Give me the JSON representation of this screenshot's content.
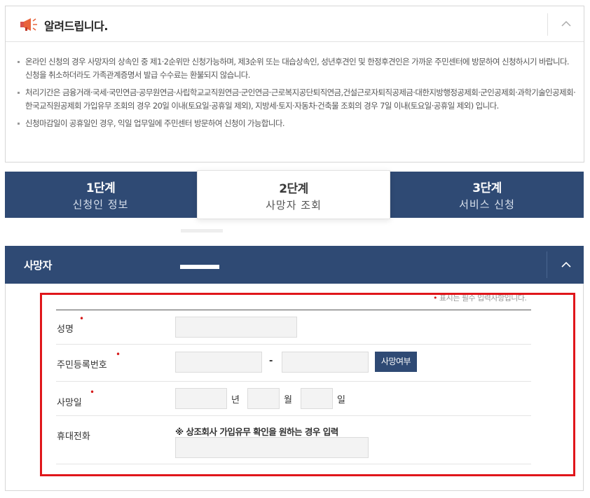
{
  "notice": {
    "title": "알려드립니다.",
    "items": [
      "온라인 신청의 경우 사망자의 상속인 중 제1·2순위만 신청가능하며, 제3순위 또는 대습상속인, 성년후견인 및 한정후견인은 가까운 주민센터에 방문하여 신청하시기 바랍니다. 신청을 취소하더라도 가족관계증명서 발급 수수료는 환불되지 않습니다.",
      "처리기간은 금융거래·국세·국민연금·공무원연금·사립학교교직원연금·군인연금·근로복지공단퇴직연금,건설근로자퇴직공제금·대한지방행정공제회·군인공제회·과학기술인공제회·한국교직원공제회 가입유무 조회의 경우 20일 이내(토요일·공휴일 제외), 지방세·토지·자동차·건축물 조회의 경우 7일 이내(토요일·공휴일 제외) 입니다.",
      "신청마감일이 공휴일인 경우, 익일 업무일에 주민센터 방문하여 신청이 가능합니다."
    ]
  },
  "steps": [
    {
      "num": "1단계",
      "label": "신청인 정보"
    },
    {
      "num": "2단계",
      "label": "사망자 조회"
    },
    {
      "num": "3단계",
      "label": "서비스 신청"
    }
  ],
  "panel": {
    "title": "사망자",
    "required_note": "표시는 필수 입력사항입니다.",
    "fields": {
      "name_label": "성명",
      "rrn_label": "주민등록번호",
      "rrn_separator": "-",
      "death_check_button": "사망여부",
      "death_date_label": "사망일",
      "year_unit": "년",
      "month_unit": "월",
      "day_unit": "일",
      "phone_label": "휴대전화",
      "phone_hint": "※ 상조회사 가입유무 확인을 원하는 경우 입력"
    }
  },
  "colors": {
    "navy": "#2f4a74",
    "required": "#d61a1a",
    "highlight": "#e0161b"
  }
}
